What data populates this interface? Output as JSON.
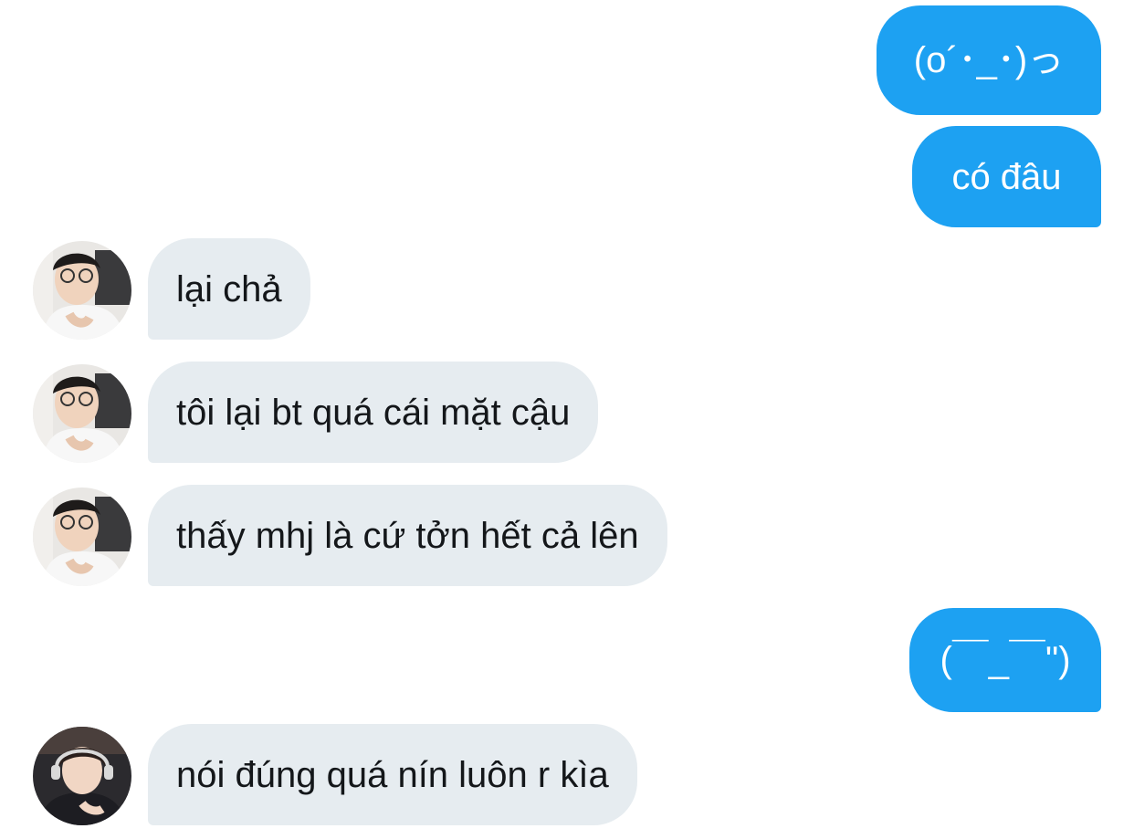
{
  "messages": [
    {
      "direction": "sent",
      "text": "(o´･_･)っ"
    },
    {
      "direction": "sent",
      "text": "có đâu"
    },
    {
      "direction": "received",
      "text": "lại chả",
      "avatar": "avatar-white-shirt-glasses"
    },
    {
      "direction": "received",
      "text": "tôi lại bt quá cái mặt cậu",
      "avatar": "avatar-white-shirt-glasses"
    },
    {
      "direction": "received",
      "text": "thấy mhj là cứ tởn hết cả lên",
      "avatar": "avatar-white-shirt-glasses"
    },
    {
      "direction": "sent",
      "text": "(￣_￣\")"
    },
    {
      "direction": "received",
      "text": "nói đúng quá nín luôn r kìa",
      "avatar": "avatar-headset-dark"
    }
  ],
  "colors": {
    "sent_bubble": "#1da1f2",
    "received_bubble": "#e6ecf0",
    "sent_text": "#ffffff",
    "received_text": "#14171a"
  },
  "icons": {
    "avatar_a": "person-with-glasses-white-shirt-avatar-icon",
    "avatar_b": "person-with-headset-dark-avatar-icon"
  }
}
